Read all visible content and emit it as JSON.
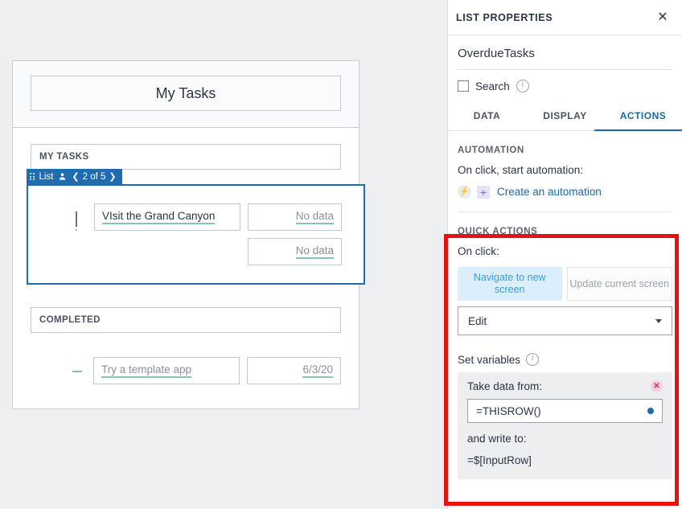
{
  "canvas": {
    "app_card": {
      "header_title": "My Tasks",
      "sections": [
        {
          "label": "MY TASKS"
        },
        {
          "label": "COMPLETED"
        }
      ],
      "list_badge": {
        "drag_icon": "drag-dots-icon",
        "label": "List",
        "person_icon": "person-icon",
        "prev_icon": "chevron-left-icon",
        "pager_text": "2 of 5",
        "next_icon": "chevron-right-icon"
      },
      "list_rows": [
        {
          "checkbox_state": "unchecked",
          "title": "VIsit the Grand Canyon",
          "value_1": "No data",
          "value_2": "No data"
        }
      ],
      "completed_rows": [
        {
          "checkbox_state": "indeterminate",
          "title": "Try a template app",
          "value_1": "6/3/20"
        }
      ]
    }
  },
  "panel": {
    "header": {
      "title": "LIST PROPERTIES",
      "close_icon": "close-icon"
    },
    "name_value": "OverdueTasks",
    "search": {
      "label": "Search",
      "checked": false,
      "info_icon": "info-icon"
    },
    "tabs": [
      {
        "label": "DATA",
        "active": false
      },
      {
        "label": "DISPLAY",
        "active": false
      },
      {
        "label": "ACTIONS",
        "active": true
      }
    ],
    "automation": {
      "section_title": "AUTOMATION",
      "subtitle": "On click, start automation:",
      "bolt_icon": "lightning-bolt-icon",
      "plus_icon": "plus-icon",
      "link_label": "Create an automation"
    },
    "quick_actions": {
      "section_title": "QUICK ACTIONS",
      "subtitle": "On click:",
      "toggles": [
        {
          "label": "Navigate to new screen",
          "selected": true
        },
        {
          "label": "Update current screen",
          "selected": false
        }
      ],
      "action_select": {
        "value": "Edit",
        "caret_icon": "chevron-down-icon"
      },
      "set_variables": {
        "label": "Set variables",
        "info_icon": "info-icon",
        "take_data_from_label": "Take data from:",
        "remove_icon": "remove-circle-icon",
        "formula_value": "=THISROW()",
        "formula_dot_icon": "blue-dot-icon",
        "and_write_to_label": "and write to:",
        "write_target": "=$[InputRow]"
      }
    }
  },
  "annotation": {
    "highlight_color": "#e8110f"
  }
}
